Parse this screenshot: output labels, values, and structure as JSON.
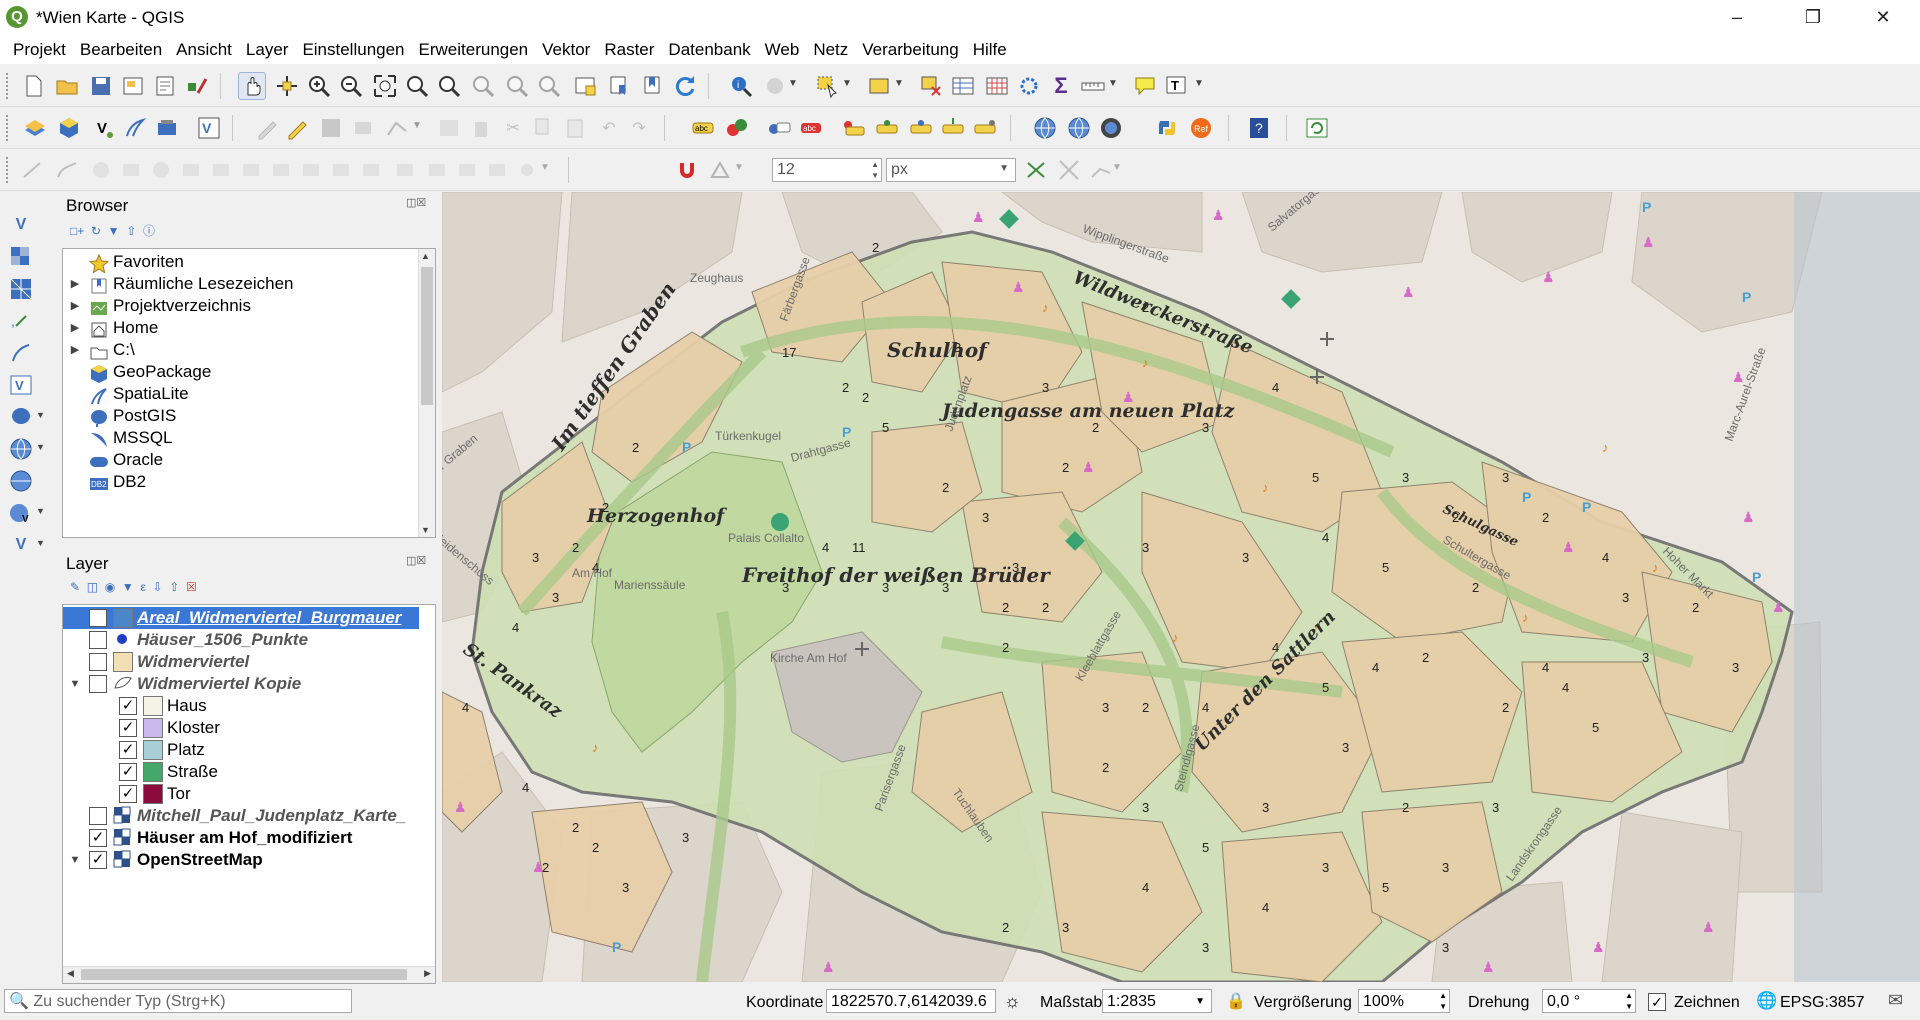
{
  "window": {
    "title": "*Wien Karte - QGIS",
    "app_icon": "Q"
  },
  "menu": [
    "Projekt",
    "Bearbeiten",
    "Ansicht",
    "Layer",
    "Einstellungen",
    "Erweiterungen",
    "Vektor",
    "Raster",
    "Datenbank",
    "Web",
    "Netz",
    "Verarbeitung",
    "Hilfe"
  ],
  "digitize_toolbar": {
    "snapping_tolerance": "12",
    "snapping_unit": "px"
  },
  "browser": {
    "title": "Browser",
    "items": [
      {
        "label": "Favoriten",
        "icon": "star-icon",
        "expandable": false
      },
      {
        "label": "Räumliche Lesezeichen",
        "icon": "bookmark-icon",
        "expandable": true
      },
      {
        "label": "Projektverzeichnis",
        "icon": "project-folder-icon",
        "expandable": true
      },
      {
        "label": "Home",
        "icon": "home-icon",
        "expandable": true
      },
      {
        "label": "C:\\",
        "icon": "drive-icon",
        "expandable": true
      },
      {
        "label": "GeoPackage",
        "icon": "geopackage-icon",
        "expandable": false
      },
      {
        "label": "SpatiaLite",
        "icon": "spatialite-icon",
        "expandable": false
      },
      {
        "label": "PostGIS",
        "icon": "postgis-icon",
        "expandable": false
      },
      {
        "label": "MSSQL",
        "icon": "mssql-icon",
        "expandable": false
      },
      {
        "label": "Oracle",
        "icon": "oracle-icon",
        "expandable": false
      },
      {
        "label": "DB2",
        "icon": "db2-icon",
        "expandable": false
      }
    ]
  },
  "layers": {
    "title": "Layer",
    "items": [
      {
        "label": "Areal_Widmerviertel_Burgmauer",
        "checked": false,
        "selected": true,
        "swatch": "#4a86c8",
        "style": "it"
      },
      {
        "label": "Häuser_1506_Punkte",
        "checked": false,
        "swatch_kind": "dot",
        "swatch": "#1f3fc8",
        "style": "it"
      },
      {
        "label": "Widmerviertel",
        "checked": false,
        "swatch": "#f2dfb6",
        "style": "it"
      },
      {
        "label": "Widmerviertel Kopie",
        "checked": false,
        "expanded": true,
        "swatch_kind": "polygon",
        "swatch": "#ffffff",
        "style": "it"
      },
      {
        "label": "Haus",
        "checked": true,
        "indent": true,
        "swatch": "#f5f3e6",
        "style": ""
      },
      {
        "label": "Kloster",
        "checked": true,
        "indent": true,
        "swatch": "#c9b8ec",
        "style": ""
      },
      {
        "label": "Platz",
        "checked": true,
        "indent": true,
        "swatch": "#a9cfd6",
        "style": ""
      },
      {
        "label": "Straße",
        "checked": true,
        "indent": true,
        "swatch": "#43a86a",
        "style": ""
      },
      {
        "label": "Tor",
        "checked": true,
        "indent": true,
        "swatch": "#8a0b3c",
        "style": ""
      },
      {
        "label": "Mitchell_Paul_Judenplatz_Karte_",
        "checked": false,
        "swatch_kind": "raster",
        "style": "it"
      },
      {
        "label": "Häuser am Hof_modifiziert",
        "checked": true,
        "swatch_kind": "raster",
        "style": "bd"
      },
      {
        "label": "OpenStreetMap",
        "checked": true,
        "expanded": true,
        "swatch_kind": "raster",
        "style": "bd"
      }
    ]
  },
  "map_labels": [
    "Im tieffen Graben",
    "Schulhof",
    "Judengasse am neuen Platz",
    "Wildwerckerstraße",
    "Herzogenhof",
    "Am Hof",
    "Freithof der weißen Brüder",
    "St. Pankraz",
    "Unter den Sattlern",
    "Schulgasse",
    "Tiefer Graben",
    "Heidenschuss",
    "Drahtgasse",
    "Färbergasse",
    "Kirche Am Hof",
    "Marienssäule",
    "Zeughaus",
    "Türkenkugel",
    "Palais Collalto",
    "Judenplatz",
    "Kleeblattgasse",
    "Tuchlauben",
    "Landskrongasse",
    "Hoher Markt",
    "Salvatorgasse",
    "Marc-Aurel-Straße",
    "Schultergasse",
    "Steindlgasse",
    "Parisergasse",
    "Wipplingerstraße"
  ],
  "status": {
    "locator_placeholder": "Zu suchender Typ (Strg+K)",
    "coord_label": "Koordinate",
    "coord_value": "1822570.7,6142039.6",
    "scale_label": "Maßstab",
    "scale_value": "1:2835",
    "zoom_label": "Vergrößerung",
    "zoom_value": "100%",
    "rotation_label": "Drehung",
    "rotation_value": "0,0 °",
    "render_label": "Zeichnen",
    "crs": "EPSG:3857"
  }
}
